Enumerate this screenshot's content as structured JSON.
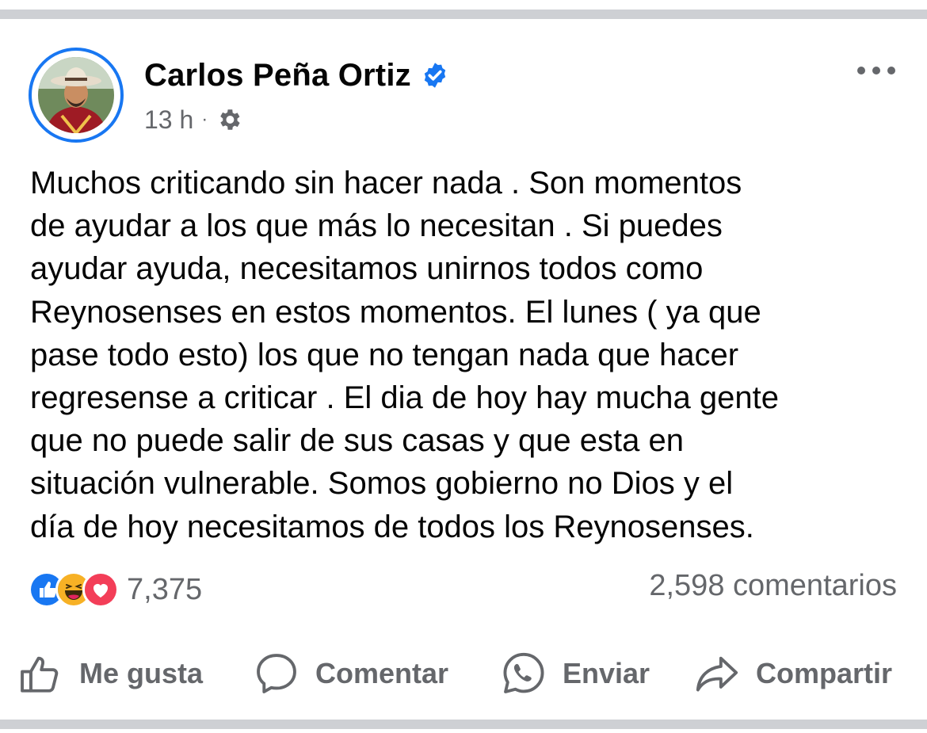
{
  "post": {
    "author": "Carlos Peña Ortiz",
    "time": "13 h",
    "separator": "·",
    "text": "Muchos criticando sin hacer nada . Son momentos\nde ayudar a los que más lo necesitan . Si puedes\nayudar ayuda, necesitamos unirnos todos como\nReynosenses en estos momentos. El lunes ( ya que\npase todo esto) los que  no tengan nada que  hacer\nregresense a criticar . El dia de hoy hay mucha gente\nque no puede salir de sus casas y que  esta en\nsituación vulnerable.  Somos gobierno no Dios  y el\ndía de hoy necesitamos de todos los Reynosenses.",
    "reaction_count": "7,375",
    "comment_count": "2,598 comentarios"
  },
  "reactions": [
    "like-reaction",
    "haha-reaction",
    "love-reaction"
  ],
  "actions": {
    "like": "Me gusta",
    "comment": "Comentar",
    "send": "Enviar",
    "share": "Compartir"
  },
  "colors": {
    "accent": "#1877f2",
    "secondary_text": "#65676b",
    "separator": "#ced0d4",
    "love": "#f33e58",
    "haha": "#f7b125"
  },
  "icons": {
    "verified": "verified-badge-icon",
    "privacy": "gear-icon",
    "more": "more-options-icon"
  }
}
